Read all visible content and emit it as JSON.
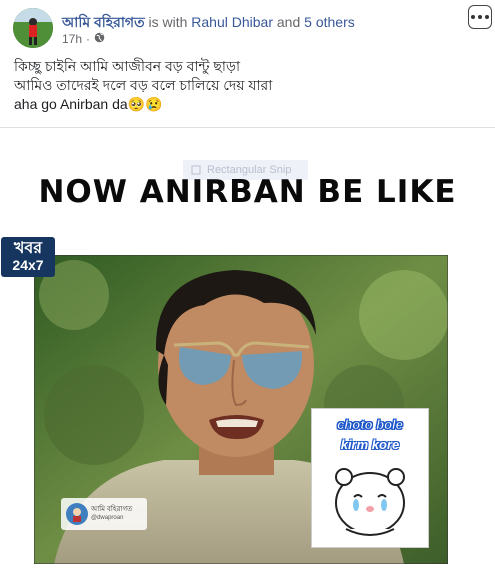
{
  "post": {
    "author": "আমি বহিরাগত",
    "with_text": " is with ",
    "tagged_name": "Rahul Dhibar",
    "and_text": " and ",
    "others": "5 others",
    "time": "17h",
    "separator": "·",
    "privacy_icon": "globe-icon",
    "more_icon": "more-options-icon",
    "lines": [
      "কিচ্ছু চাইনি আমি আজীবন বড় বান্টু ছাড়া",
      "আমিও তাদেরই দলে বড় বলে চালিয়ে দেয় যারা",
      "aha go Anirban da🥺😢"
    ]
  },
  "image": {
    "snip_label": "Rectangular Snip",
    "headline": "NOW ANIRBAN BE LIKE",
    "channel_line1": "খবর",
    "channel_line2": "24x7",
    "sticker_line1": "choto bole",
    "sticker_line2": "kirm kore",
    "watermark_name": "আমি বহিরাগত",
    "watermark_handle": "@dwaproan"
  },
  "colors": {
    "link": "#385898",
    "meta": "#65676b",
    "text": "#1c1e21",
    "channel_bg": "#17365f"
  }
}
